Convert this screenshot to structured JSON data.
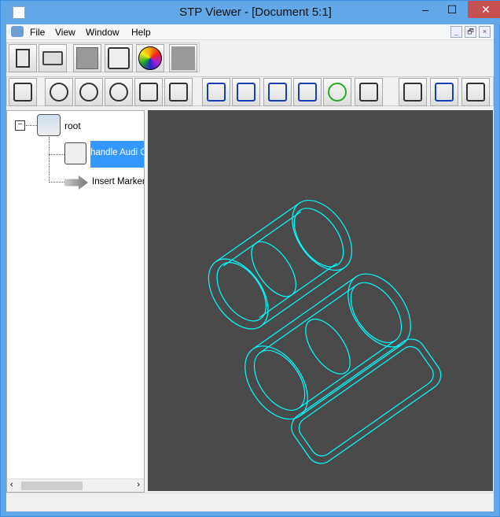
{
  "window": {
    "title": "STP Viewer - [Document 5:1]",
    "minimize": "–",
    "maximize": "☐",
    "close": "✕"
  },
  "menu": {
    "items": [
      "File",
      "View",
      "Window",
      "Help"
    ],
    "mdi": [
      "_",
      "🗗",
      "×"
    ]
  },
  "toolbar1": [
    "paste-icon",
    "open-folder-icon",
    "shaded-box-icon",
    "white-box-icon",
    "color-wheel-icon",
    "blank-icon"
  ],
  "toolbar2": [
    "select-properties-icon",
    "zoom-icon",
    "zoom-box-icon",
    "zoom-rotate-icon",
    "pan-move-icon",
    "pan-hand-icon",
    "top-view-icon",
    "bottom-view-icon",
    "front-view-icon",
    "side-view-icon",
    "orbit-icon",
    "home-icon",
    "solid-cube-icon",
    "wireframe-cube-icon",
    "axes-icon"
  ],
  "tree": {
    "root": "root",
    "children": [
      "handle Audi C",
      "Insert Marker"
    ]
  },
  "colors": {
    "wire": "#00ffff",
    "viewport": "#4a4a4a",
    "selection": "#3399ff"
  }
}
